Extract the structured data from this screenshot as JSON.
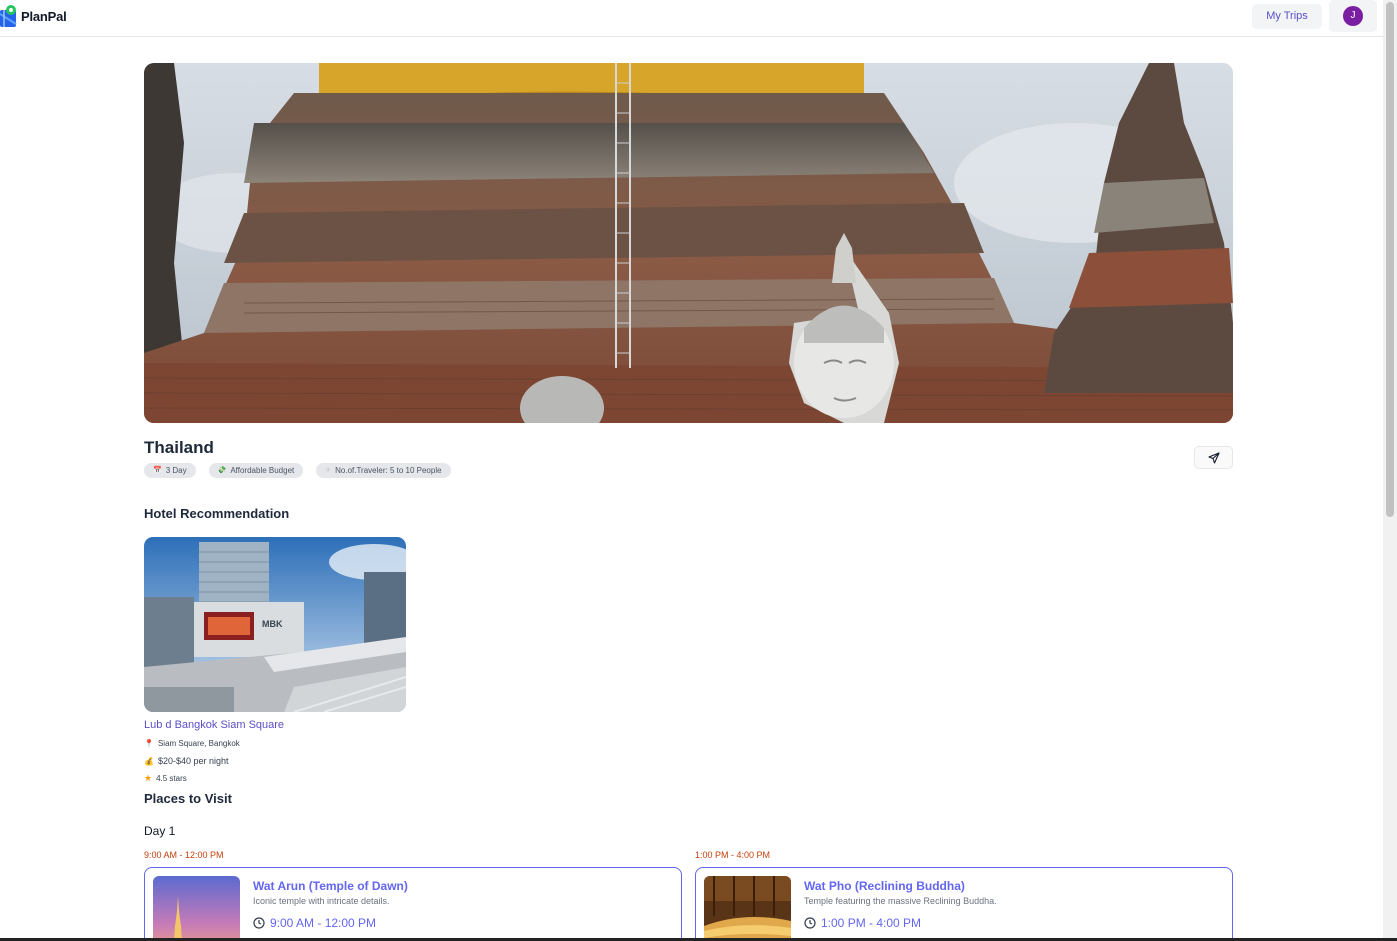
{
  "app": {
    "name": "PlanPal"
  },
  "header": {
    "my_trips_label": "My Trips",
    "avatar_initial": "J"
  },
  "trip": {
    "title": "Thailand",
    "chips": [
      {
        "icon": "calendar-icon",
        "label": "3 Day"
      },
      {
        "icon": "money-icon",
        "label": "Affordable Budget"
      },
      {
        "icon": "traveler-icon",
        "label": "No.of.Traveler: 5 to 10 People"
      }
    ]
  },
  "hotels": {
    "section_title": "Hotel Recommendation",
    "items": [
      {
        "name": "Lub d Bangkok Siam Square",
        "address": "Siam Square, Bangkok",
        "price": "$20-$40 per night",
        "rating": "4.5 stars"
      }
    ]
  },
  "places": {
    "section_title": "Places to Visit",
    "days": [
      {
        "label": "Day 1",
        "items": [
          {
            "time_label": "9:00 AM - 12:00 PM",
            "name": "Wat Arun (Temple of Dawn)",
            "description": "Iconic temple with intricate details.",
            "time": "9:00 AM - 12:00 PM"
          },
          {
            "time_label": "1:00 PM - 4:00 PM",
            "name": "Wat Pho (Reclining Buddha)",
            "description": "Temple featuring the massive Reclining Buddha.",
            "time": "1:00 PM - 4:00 PM"
          }
        ]
      }
    ]
  },
  "colors": {
    "accent": "#6366f1",
    "brand_link": "#5b4fc7",
    "time_label": "#c2410c",
    "avatar_bg": "#7b1fa2"
  }
}
